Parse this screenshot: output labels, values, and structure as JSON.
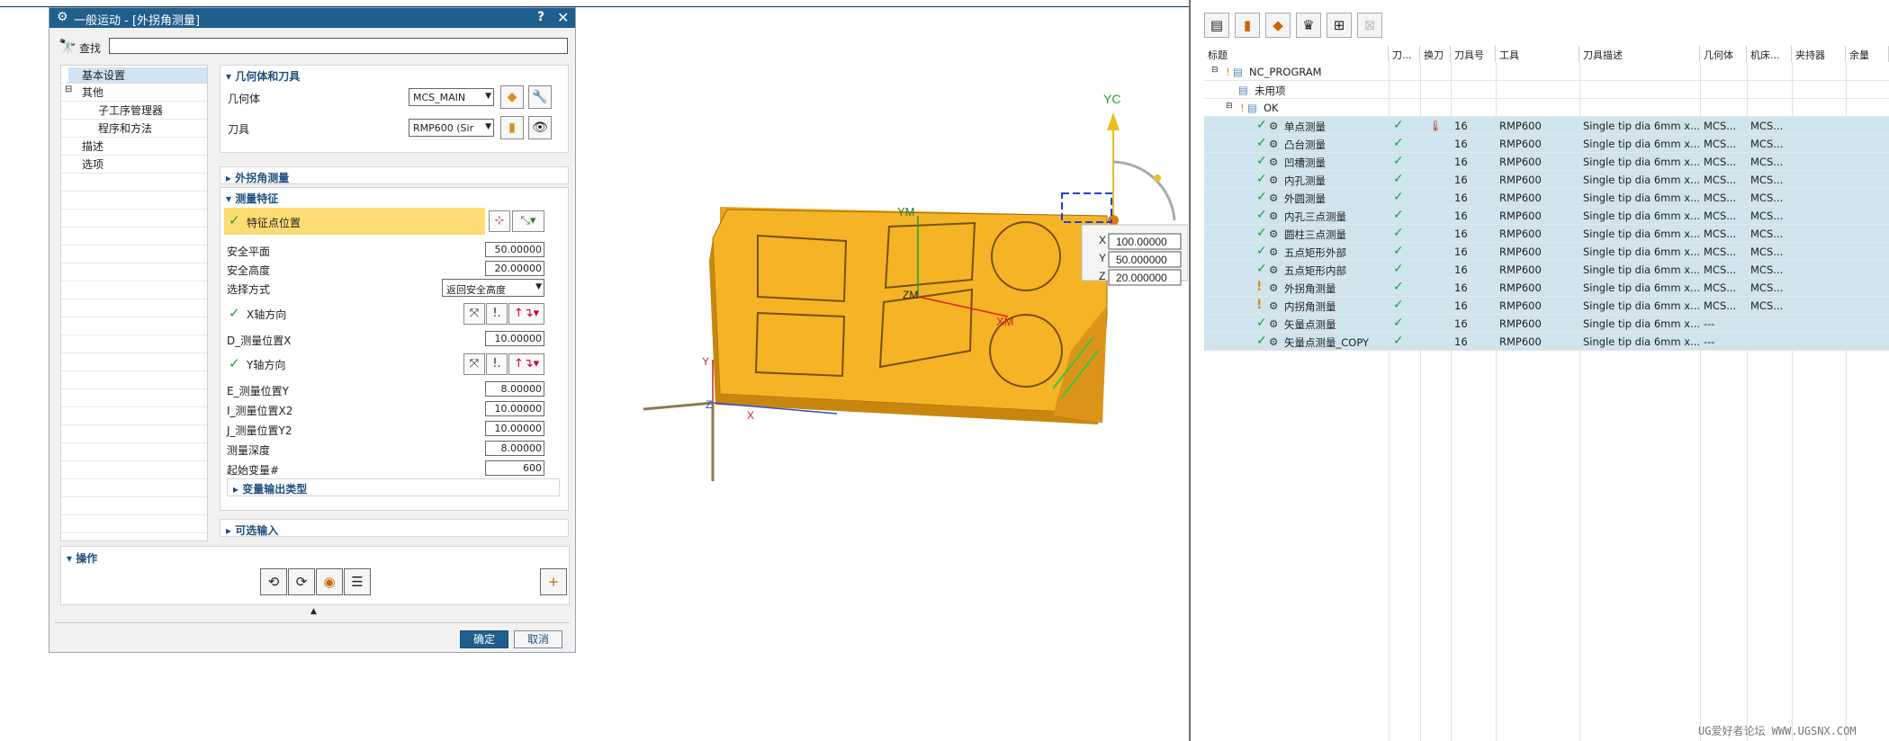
{
  "dialog": {
    "title": "一般运动 - [外拐角测量]",
    "help": "?",
    "close": "✕",
    "find_label": "查找",
    "find_value": "",
    "nav": [
      "基本设置",
      "其他",
      "子工序管理器",
      "程序和方法",
      "描述",
      "选项"
    ],
    "sections": {
      "geom_tool": "几何体和刀具",
      "outer_corner": "外拐角测量",
      "measure_feature": "测量特征",
      "var_output": "变量输出类型",
      "optional_input": "可选输入"
    },
    "geometry_label": "几何体",
    "geometry_value": "MCS_MAIN",
    "tool_label": "刀具",
    "tool_value": "RMP600 (Sir",
    "feature_point": "特征点位置",
    "safe_plane_label": "安全平面",
    "safe_plane_value": "50.00000",
    "safe_height_label": "安全高度",
    "safe_height_value": "20.00000",
    "select_mode_label": "选择方式",
    "select_mode_value": "返回安全高度",
    "x_axis_label": "X轴方向",
    "d_label": "D_测量位置X",
    "d_value": "10.00000",
    "y_axis_label": "Y轴方向",
    "e_label": "E_测量位置Y",
    "e_value": "8.00000",
    "i_label": "I_测量位置X2",
    "i_value": "10.00000",
    "j_label": "J_测量位置Y2",
    "j_value": "10.00000",
    "depth_label": "测量深度",
    "depth_value": "8.00000",
    "start_var_label": "起始变量#",
    "start_var_value": "600",
    "ops_label": "操作",
    "ok": "确定",
    "cancel": "取消"
  },
  "view": {
    "axes": {
      "yc": "YC",
      "xm": "XM",
      "ym": "YM",
      "zm": "ZM",
      "x": "X",
      "y": "Y",
      "z": "Z"
    },
    "coords": [
      {
        "axis": "X",
        "value": "100.00000"
      },
      {
        "axis": "Y",
        "value": "50.000000"
      },
      {
        "axis": "Z",
        "value": "20.000000"
      }
    ]
  },
  "navigator": {
    "headers": [
      "标题",
      "刀...",
      "换刀",
      "刀具号",
      "工具",
      "刀具描述",
      "几何体",
      "机床...",
      "夹持器",
      "余量"
    ],
    "root": "NC_PROGRAM",
    "unused": "未用项",
    "group": "OK",
    "rows": [
      {
        "name": "单点测量",
        "ok": true,
        "toolchange": true,
        "no": "16",
        "tool": "RMP600",
        "desc": "Single tip dia 6mm x...",
        "geom": "MCS...",
        "machine": "MCS..."
      },
      {
        "name": "凸台测量",
        "ok": true,
        "toolchange": false,
        "no": "16",
        "tool": "RMP600",
        "desc": "Single tip dia 6mm x...",
        "geom": "MCS...",
        "machine": "MCS..."
      },
      {
        "name": "凹槽测量",
        "ok": true,
        "toolchange": false,
        "no": "16",
        "tool": "RMP600",
        "desc": "Single tip dia 6mm x...",
        "geom": "MCS...",
        "machine": "MCS..."
      },
      {
        "name": "内孔测量",
        "ok": true,
        "toolchange": false,
        "no": "16",
        "tool": "RMP600",
        "desc": "Single tip dia 6mm x...",
        "geom": "MCS...",
        "machine": "MCS..."
      },
      {
        "name": "外圆测量",
        "ok": true,
        "toolchange": false,
        "no": "16",
        "tool": "RMP600",
        "desc": "Single tip dia 6mm x...",
        "geom": "MCS...",
        "machine": "MCS..."
      },
      {
        "name": "内孔三点测量",
        "ok": true,
        "toolchange": false,
        "no": "16",
        "tool": "RMP600",
        "desc": "Single tip dia 6mm x...",
        "geom": "MCS...",
        "machine": "MCS..."
      },
      {
        "name": "圆柱三点测量",
        "ok": true,
        "toolchange": false,
        "no": "16",
        "tool": "RMP600",
        "desc": "Single tip dia 6mm x...",
        "geom": "MCS...",
        "machine": "MCS..."
      },
      {
        "name": "五点矩形外部",
        "ok": true,
        "toolchange": false,
        "no": "16",
        "tool": "RMP600",
        "desc": "Single tip dia 6mm x...",
        "geom": "MCS...",
        "machine": "MCS..."
      },
      {
        "name": "五点矩形内部",
        "ok": true,
        "toolchange": false,
        "no": "16",
        "tool": "RMP600",
        "desc": "Single tip dia 6mm x...",
        "geom": "MCS...",
        "machine": "MCS..."
      },
      {
        "name": "外拐角测量",
        "ok": false,
        "toolchange": false,
        "no": "16",
        "tool": "RMP600",
        "desc": "Single tip dia 6mm x...",
        "geom": "MCS...",
        "machine": "MCS..."
      },
      {
        "name": "内拐角测量",
        "ok": false,
        "toolchange": false,
        "no": "16",
        "tool": "RMP600",
        "desc": "Single tip dia 6mm x...",
        "geom": "MCS...",
        "machine": "MCS..."
      },
      {
        "name": "矢量点测量",
        "ok": true,
        "toolchange": false,
        "no": "16",
        "tool": "RMP600",
        "desc": "Single tip dia 6mm x...",
        "geom": "---",
        "machine": ""
      },
      {
        "name": "矢量点测量_COPY",
        "ok": true,
        "toolchange": false,
        "no": "16",
        "tool": "RMP600",
        "desc": "Single tip dia 6mm x...",
        "geom": "---",
        "machine": ""
      }
    ]
  },
  "watermark": "UG爱好者论坛 WWW.UGSNX.COM",
  "colors": {
    "title_bar": "#1f5f8e",
    "highlight_row": "#cfe4ec",
    "part": "#f5b323",
    "ok_green": "#1e9e34"
  }
}
